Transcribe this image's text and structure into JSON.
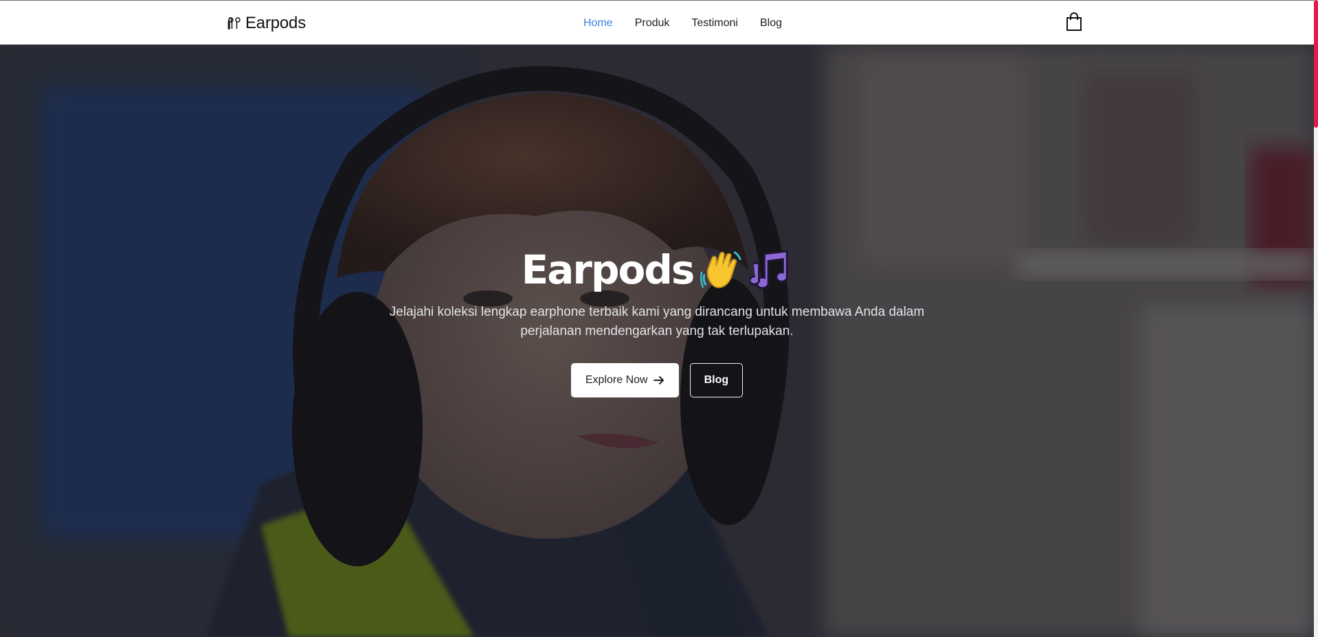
{
  "nav": {
    "brand": "Earpods",
    "links": [
      {
        "label": "Home",
        "active": true
      },
      {
        "label": "Produk",
        "active": false
      },
      {
        "label": "Testimoni",
        "active": false
      },
      {
        "label": "Blog",
        "active": false
      }
    ],
    "cart_icon": "shopping-bag-icon"
  },
  "hero": {
    "title": "Earpods",
    "emojis": [
      "waving-hand-icon",
      "musical-notes-icon"
    ],
    "subtitle": "Jelajahi koleksi lengkap earphone terbaik kami yang dirancang untuk membawa Anda dalam perjalanan mendengarkan yang tak terlupakan.",
    "primary_button": "Explore Now",
    "secondary_button": "Blog"
  },
  "colors": {
    "accent_active": "#3b82e0",
    "scrollbar": "#e11d48"
  }
}
